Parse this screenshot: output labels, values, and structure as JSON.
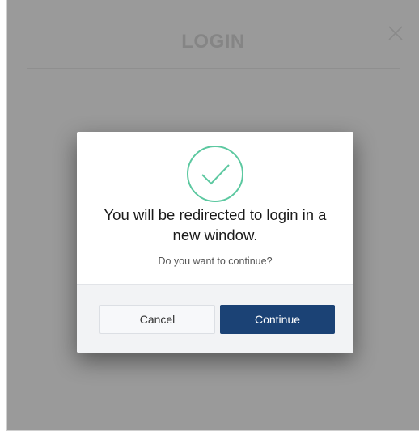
{
  "background": {
    "title": "LOGIN",
    "close_icon": "close-icon"
  },
  "dialog": {
    "icon": "check-circle-icon",
    "message": "You will be redirected to login in a new window.",
    "question": "Do you want to continue?",
    "cancel_label": "Cancel",
    "continue_label": "Continue"
  },
  "colors": {
    "accent_check": "#5cc8a0",
    "primary_button": "#1b4275",
    "overlay": "#9a9a9a"
  }
}
